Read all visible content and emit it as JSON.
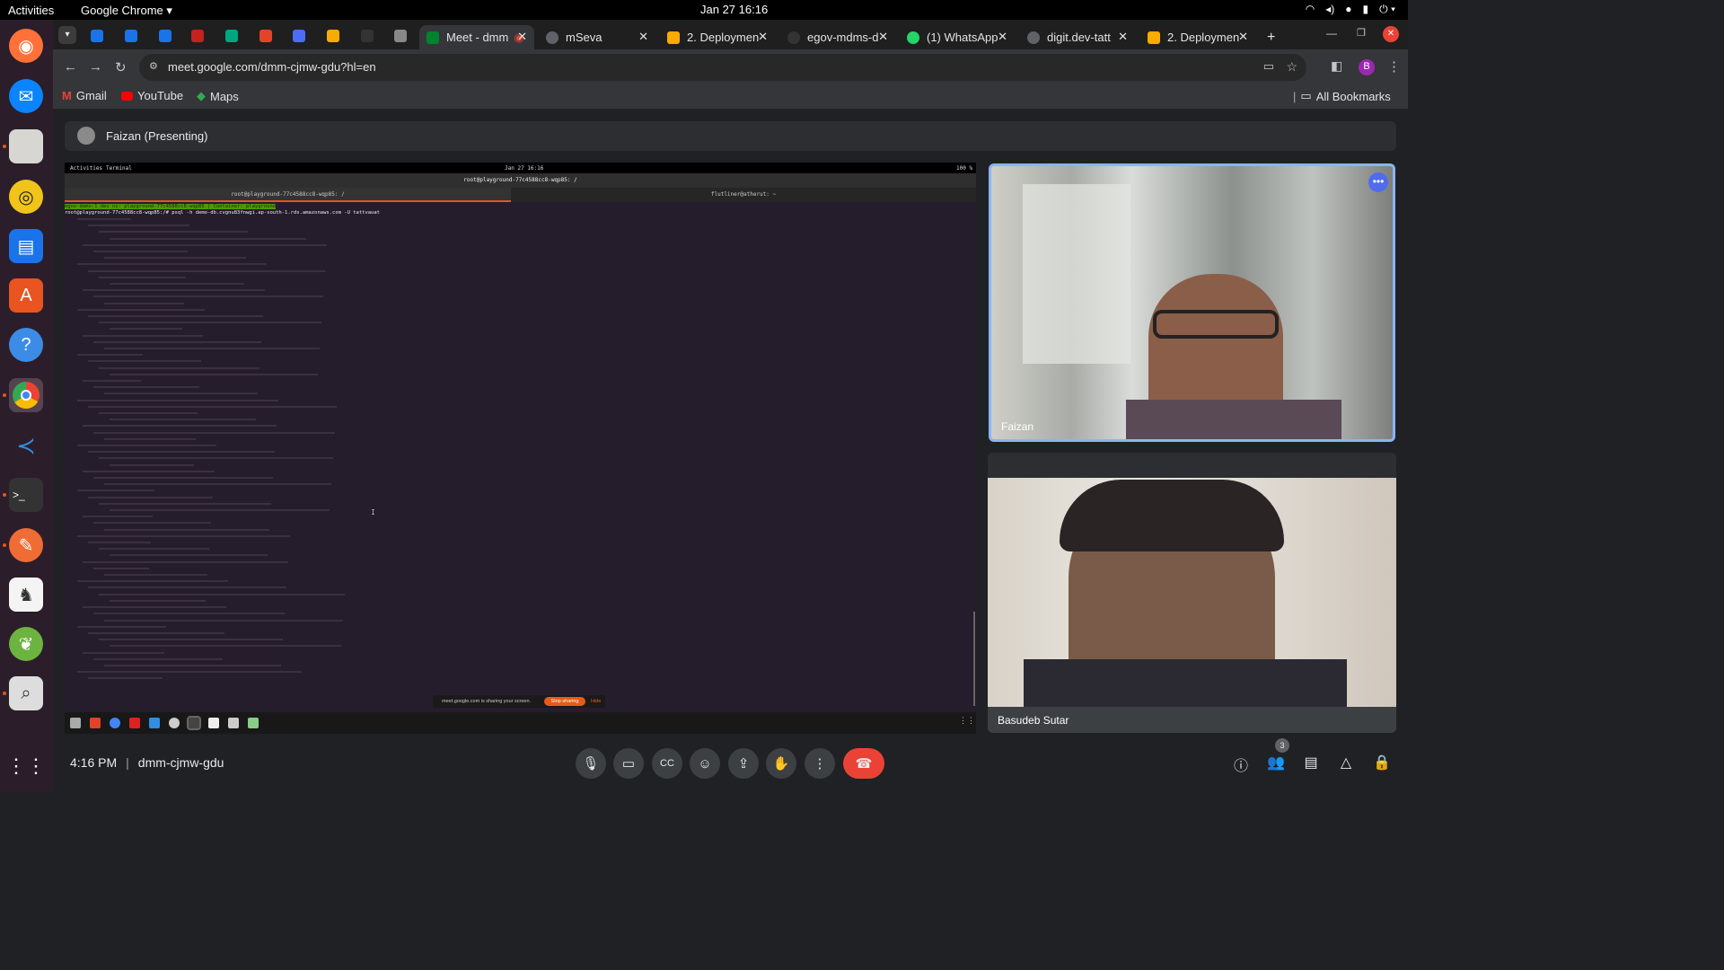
{
  "os": {
    "activities": "Activities",
    "app": "Google Chrome",
    "clock": "Jan 27  16:16",
    "tray": [
      "wifi",
      "volume",
      "mic",
      "battery",
      "power"
    ]
  },
  "dock": {
    "items": [
      "firefox",
      "thunderbird",
      "files",
      "rhythmbox",
      "libreoffice-writer",
      "app-center",
      "help",
      "chrome",
      "vscode",
      "terminal",
      "postman",
      "gimp",
      "spring",
      "search",
      "app-grid"
    ]
  },
  "chrome": {
    "tabs": [
      {
        "label": "Meet - dmm",
        "active": true
      },
      {
        "label": "mSeva"
      },
      {
        "label": "2. Deploymen"
      },
      {
        "label": "egov-mdms-d"
      },
      {
        "label": "(1) WhatsApp"
      },
      {
        "label": "digit.dev-tatt"
      },
      {
        "label": "2. Deploymen"
      }
    ],
    "new_tab": "+",
    "url": "meet.google.com/dmm-cjmw-gdu?hl=en",
    "bookmarks": [
      "Gmail",
      "YouTube",
      "Maps"
    ],
    "all_bookmarks": "All Bookmarks",
    "profile_initial": "B"
  },
  "meet": {
    "presenter_label": "Faizan (Presenting)",
    "time": "4:16 PM",
    "meeting_code": "dmm-cjmw-gdu",
    "participants": [
      {
        "name": "Faizan"
      },
      {
        "name": "Basudeb Sutar"
      }
    ],
    "people_count": "3"
  },
  "shared_screen": {
    "activities": "Activities",
    "app": "Terminal",
    "clock": "Jan 27  16:16",
    "battery": "100 %",
    "window_title": "root@playground-77c4588cc8-wqp85: /",
    "tab1": "root@playground-77c4588cc8-wqp85: /",
    "tab2": "flutliner@atherut: ~",
    "prompt_line": "egov-demo-1  dev  ns: playground-77c4588cc8-wqp85  | Container: playground",
    "command": "root@playground-77c4588cc8-wqp85:/# psql -h demo-db.cvgnu83fnwgi.ap-south-1.rds.amazonaws.com -U tattvauat",
    "share_message": "meet.google.com is sharing your screen.",
    "stop_sharing": "Stop sharing",
    "hide": "Hide"
  }
}
